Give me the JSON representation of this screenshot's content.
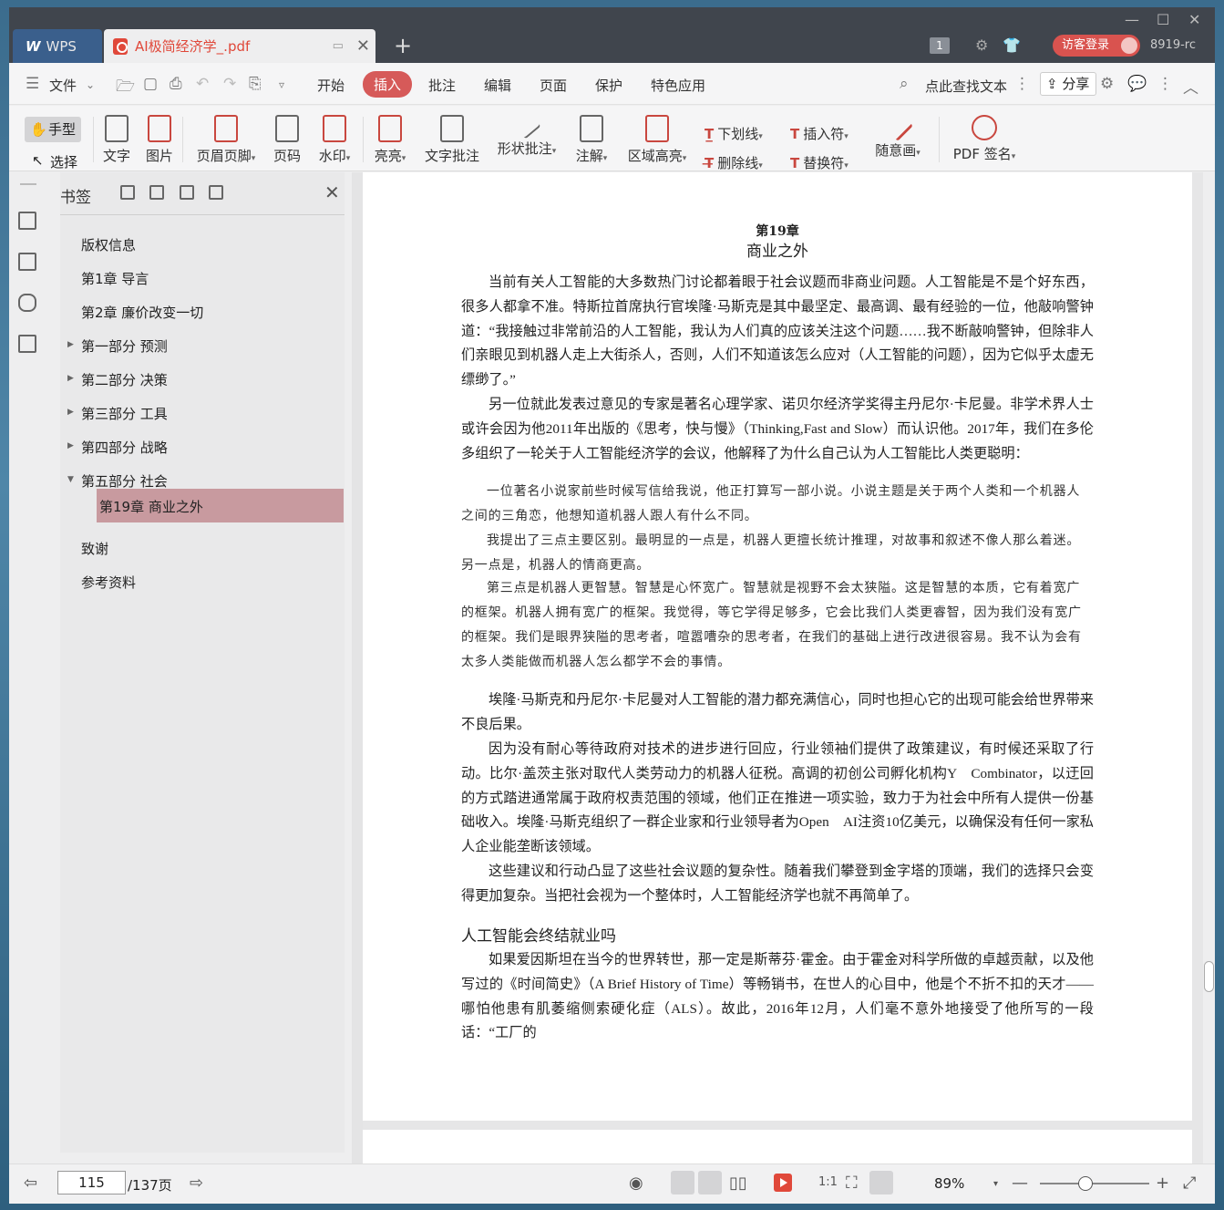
{
  "titlebar": {
    "wps_tab": "WPS",
    "doc_tab": "AI极简经济学_.pdf",
    "page_badge": "1",
    "login": "访客登录",
    "version": "8919-rc"
  },
  "menubar": {
    "file": "文件",
    "items": [
      "开始",
      "插入",
      "批注",
      "编辑",
      "页面",
      "保护",
      "特色应用"
    ],
    "active": "插入",
    "search": "点此查找文本",
    "share": "分享"
  },
  "ribbon": {
    "hand": "手型",
    "select": "选择",
    "text": "文字",
    "image": "图片",
    "header_footer": "页眉页脚",
    "page_num": "页码",
    "watermark": "水印",
    "highlight": "亮亮",
    "text_comment": "文字批注",
    "shape_comment": "形状批注",
    "annotation": "注解",
    "area_highlight": "区域高亮",
    "underline": "下划线",
    "strikethrough": "删除线",
    "insert_mark": "插入符",
    "replace_mark": "替换符",
    "freehand": "随意画",
    "pdf_sign": "PDF 签名"
  },
  "bookmarks": {
    "title": "书签",
    "items": [
      {
        "label": "版权信息"
      },
      {
        "label": "第1章 导言"
      },
      {
        "label": "第2章 廉价改变一切"
      },
      {
        "label": "第一部分 预测"
      },
      {
        "label": "第二部分 决策"
      },
      {
        "label": "第三部分 工具"
      },
      {
        "label": "第四部分 战略"
      },
      {
        "label": "第五部分 社会"
      },
      {
        "label": "第19章 商业之外"
      },
      {
        "label": "致谢"
      },
      {
        "label": "参考资料"
      }
    ]
  },
  "document": {
    "chapter_num": "第19章",
    "chapter_title": "商业之外",
    "p1": "当前有关人工智能的大多数热门讨论都着眼于社会议题而非商业问题。人工智能是不是个好东西，很多人都拿不准。特斯拉首席执行官埃隆·马斯克是其中最坚定、最高调、最有经验的一位，他敲响警钟道：“我接触过非常前沿的人工智能，我认为人们真的应该关注这个问题……我不断敲响警钟，但除非人们亲眼见到机器人走上大街杀人，否则，人们不知道该怎么应对（人工智能的问题），因为它似乎太虚无缥缈了。”",
    "p2": "另一位就此发表过意见的专家是著名心理学家、诺贝尔经济学奖得主丹尼尔·卡尼曼。非学术界人士或许会因为他2011年出版的《思考，快与慢》（Thinking,Fast and Slow）而认识他。2017年，我们在多伦多组织了一轮关于人工智能经济学的会议，他解释了为什么自己认为人工智能比人类更聪明：",
    "q1": "一位著名小说家前些时候写信给我说，他正打算写一部小说。小说主题是关于两个人类和一个机器人之间的三角恋，他想知道机器人跟人有什么不同。",
    "q2": "我提出了三点主要区别。最明显的一点是，机器人更擅长统计推理，对故事和叙述不像人那么着迷。另一点是，机器人的情商更高。",
    "q3": "第三点是机器人更智慧。智慧是心怀宽广。智慧就是视野不会太狭隘。这是智慧的本质，它有着宽广的框架。机器人拥有宽广的框架。我觉得，等它学得足够多，它会比我们人类更睿智，因为我们没有宽广的框架。我们是眼界狭隘的思考者，喧嚣嘈杂的思考者，在我们的基础上进行改进很容易。我不认为会有太多人类能做而机器人怎么都学不会的事情。",
    "p3": "埃隆·马斯克和丹尼尔·卡尼曼对人工智能的潜力都充满信心，同时也担心它的出现可能会给世界带来不良后果。",
    "p4": "因为没有耐心等待政府对技术的进步进行回应，行业领袖们提供了政策建议，有时候还采取了行动。比尔·盖茨主张对取代人类劳动力的机器人征税。高调的初创公司孵化机构Y　Combinator，以迂回的方式踏进通常属于政府权责范围的领域，他们正在推进一项实验，致力于为社会中所有人提供一份基础收入。埃隆·马斯克组织了一群企业家和行业领导者为Open　AI注资10亿美元，以确保没有任何一家私人企业能垄断该领域。",
    "p5": "这些建议和行动凸显了这些社会议题的复杂性。随着我们攀登到金字塔的顶端，我们的选择只会变得更加复杂。当把社会视为一个整体时，人工智能经济学也就不再简单了。",
    "h2": "人工智能会终结就业吗",
    "p6": "如果爱因斯坦在当今的世界转世，那一定是斯蒂芬·霍金。由于霍金对科学所做的卓越贡献，以及他写过的《时间简史》（A Brief History of Time）等畅销书，在世人的心目中，他是个不折不扣的天才——哪怕他患有肌萎缩侧索硬化症（ALS）。故此，2016年12月，人们毫不意外地接受了他所写的一段话：“工厂的"
  },
  "statusbar": {
    "page_current": "115",
    "page_total": "/137页",
    "zoom": "89%",
    "zoom_level": 0.42
  },
  "colors": {
    "accent": "#d65a59",
    "bookmark_active": "#c89a9f",
    "titlebar": "#40454d"
  }
}
